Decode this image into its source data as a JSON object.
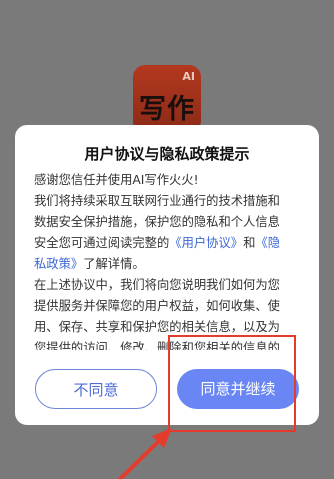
{
  "app_logo": {
    "badge": "AI",
    "text": "写作"
  },
  "dialog": {
    "title": "用户协议与隐私政策提示",
    "para1_lines": [
      "感谢您信任并使用AI写作火火!",
      "我们将持续采取互联网行业通行的技术措施和",
      "数据安全保护措施，保护您的隐私和个人信息"
    ],
    "para1_tail_prefix": "安全您可通过阅读完整的",
    "link_user_agreement": "《用户协议》",
    "and_text": "和",
    "link_privacy_part1": "《隐",
    "link_privacy_part2": "私政策》",
    "para1_end": "了解详情。",
    "para2_lines": [
      "在上述协议中，我们将向您说明我们如何为您",
      "提供服务并保障您的用户权益，如何收集、使",
      "用、保存、共享和保护您的相关信息，以及为",
      "您提供的访问、修改、删除和您相关的信息的"
    ],
    "disagree_label": "不同意",
    "agree_label": "同意并继续"
  },
  "colors": {
    "accent": "#6a86f5",
    "link": "#3b66d6",
    "annotation": "#e43b2c",
    "overlay": "#7a7a7a"
  }
}
